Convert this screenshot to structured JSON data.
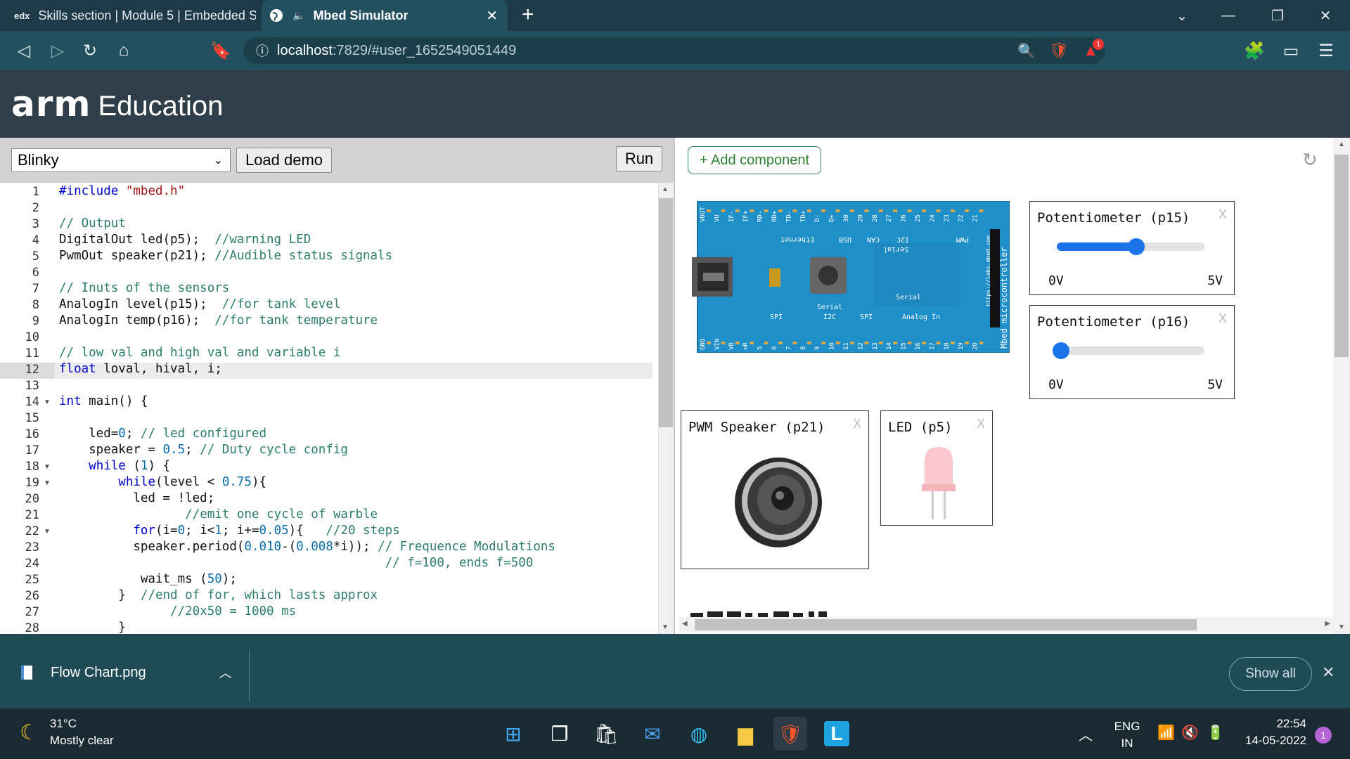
{
  "browser": {
    "tabs": [
      {
        "label": "Skills section | Module 5 | Embedded S",
        "icon": "edx"
      },
      {
        "label": "Mbed Simulator",
        "icon": "globe-icon"
      }
    ],
    "url_host": "localhost",
    "url_path": ":7829/#user_1652549051449",
    "shields_badge": "1"
  },
  "header": {
    "logo": "arm",
    "product": "Education"
  },
  "left": {
    "demo_selected": "Blinky",
    "load_demo_label": "Load demo",
    "run_label": "Run",
    "code_lines": [
      {
        "n": "1",
        "html": "<span class='pp'>#include</span> <span class='str'>\"mbed.h\"</span>"
      },
      {
        "n": "2",
        "html": ""
      },
      {
        "n": "3",
        "html": "<span class='cm'>// Output</span>"
      },
      {
        "n": "4",
        "html": "DigitalOut led(p5);  <span class='cm'>//warning LED</span>"
      },
      {
        "n": "5",
        "html": "PwmOut speaker(p21); <span class='cm'>//Audible status signals</span>"
      },
      {
        "n": "6",
        "html": ""
      },
      {
        "n": "7",
        "html": "<span class='cm'>// Inuts of the sensors</span>"
      },
      {
        "n": "8",
        "html": "AnalogIn level(p15);  <span class='cm'>//for tank level</span>"
      },
      {
        "n": "9",
        "html": "AnalogIn temp(p16);  <span class='cm'>//for tank temperature</span>"
      },
      {
        "n": "10",
        "html": ""
      },
      {
        "n": "11",
        "html": "<span class='cm'>// low val and high val and variable i</span>"
      },
      {
        "n": "12",
        "html": "<span class='kw'>float</span> loval, hival, i;"
      },
      {
        "n": "13",
        "html": ""
      },
      {
        "n": "14",
        "html": "<span class='kw'>int</span> main() {",
        "fold": true
      },
      {
        "n": "15",
        "html": ""
      },
      {
        "n": "16",
        "html": "    led=<span class='num'>0</span>; <span class='cm'>// led configured</span>"
      },
      {
        "n": "17",
        "html": "    speaker = <span class='num'>0.5</span>; <span class='cm'>// Duty cycle config</span>"
      },
      {
        "n": "18",
        "html": "    <span class='kw'>while</span> (<span class='num'>1</span>) {",
        "fold": true
      },
      {
        "n": "19",
        "html": "        <span class='kw'>while</span>(level &lt; <span class='num'>0.75</span>){",
        "fold": true
      },
      {
        "n": "20",
        "html": "          led = !led;"
      },
      {
        "n": "21",
        "html": "                 <span class='cm'>//emit one cycle of warble</span>"
      },
      {
        "n": "22",
        "html": "          <span class='kw'>for</span>(i=<span class='num'>0</span>; i&lt;<span class='num'>1</span>; i+=<span class='num'>0.05</span>){   <span class='cm'>//20 steps</span>",
        "fold": true
      },
      {
        "n": "23",
        "html": "          speaker.period(<span class='num'>0.010</span>-(<span class='num'>0.008</span>*i)); <span class='cm'>// Frequence Modulations</span>"
      },
      {
        "n": "24",
        "html": "                                            <span class='cm'>// f=100, ends f=500</span>"
      },
      {
        "n": "25",
        "html": "           wait_ms (<span class='num'>50</span>);"
      },
      {
        "n": "26",
        "html": "        }  <span class='cm'>//end of for, which lasts approx</span>"
      },
      {
        "n": "27",
        "html": "               <span class='cm'>//20x50 = 1000 ms</span>"
      },
      {
        "n": "28",
        "html": "        }"
      }
    ]
  },
  "right": {
    "add_component_label": "+ Add component",
    "board": {
      "top_pins": [
        "VOUT",
        "VU",
        "IF-",
        "IF+",
        "RD-",
        "RD+",
        "TD-",
        "TD+",
        "D-",
        "D+",
        "30",
        "29",
        "28",
        "27",
        "26",
        "25",
        "24",
        "23",
        "22",
        "21"
      ],
      "bottom_pins": [
        "GND",
        "VIN",
        "VB",
        "nR",
        "5",
        "6",
        "7",
        "8",
        "9",
        "10",
        "11",
        "12",
        "13",
        "14",
        "15",
        "16",
        "17",
        "18",
        "19",
        "20"
      ],
      "top_labels": [
        "Ethernet",
        "USB",
        "CAN",
        "I2C",
        "PWM"
      ],
      "serial_top": "Serial",
      "bottom_labels": [
        "SPI",
        "Serial I2C",
        "SPI",
        "Analog In"
      ],
      "serial_mid": "Serial",
      "side_text": "Mbed microcontroller",
      "url_text": "https://labs.mbed.com"
    },
    "pot1": {
      "title": "Potentiometer (p15)",
      "min": "0V",
      "max": "5V",
      "value_fraction": 0.54
    },
    "pot2": {
      "title": "Potentiometer (p16)",
      "min": "0V",
      "max": "5V",
      "value_fraction": 0.03
    },
    "speaker": {
      "title": "PWM Speaker (p21)"
    },
    "led": {
      "title": "LED (p5)"
    },
    "close_symbol": "X"
  },
  "downloads": {
    "file": "Flow Chart.png",
    "show_all": "Show all"
  },
  "taskbar": {
    "temp": "31°C",
    "weather": "Mostly clear",
    "lang1": "ENG",
    "lang2": "IN",
    "time": "22:54",
    "date": "14-05-2022",
    "notif": "1"
  }
}
